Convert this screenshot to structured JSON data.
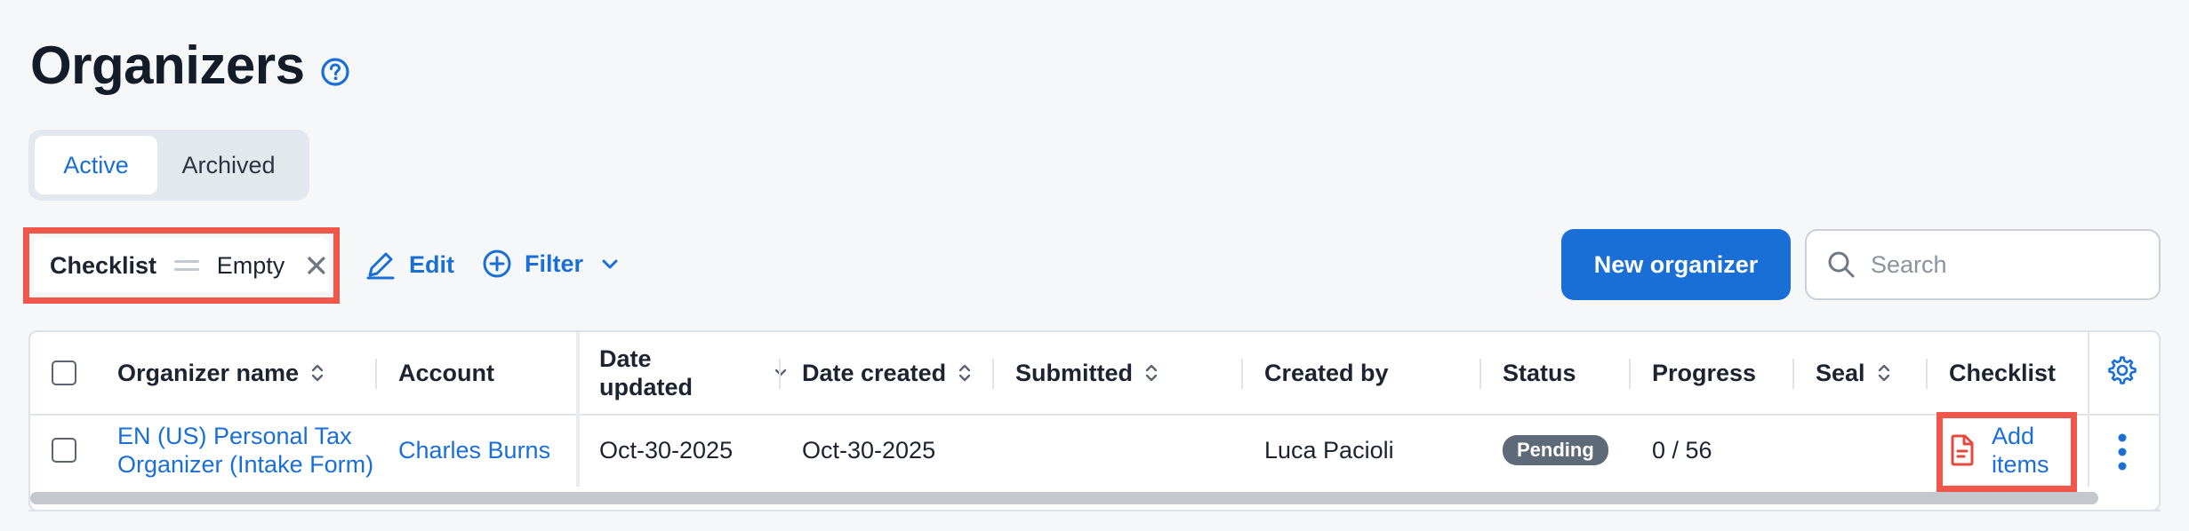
{
  "header": {
    "title": "Organizers",
    "help_icon": "help-circle-icon"
  },
  "tabs": {
    "active": "Active",
    "archived": "Archived"
  },
  "filter_chip": {
    "key": "Checklist",
    "operator_icon": "equals-icon",
    "value": "Empty",
    "remove_icon": "close-icon"
  },
  "toolbar": {
    "edit_label": "Edit",
    "filter_label": "Filter",
    "new_button": "New organizer",
    "search_placeholder": "Search"
  },
  "table": {
    "columns": {
      "organizer_name": "Organizer name",
      "account": "Account",
      "date_updated": "Date updated",
      "date_created": "Date created",
      "submitted": "Submitted",
      "created_by": "Created by",
      "status": "Status",
      "progress": "Progress",
      "seal": "Seal",
      "checklist": "Checklist"
    },
    "rows": [
      {
        "organizer_name": "EN (US) Personal Tax Organizer (Intake Form)",
        "account": "Charles Burns",
        "date_updated": "Oct-30-2025",
        "date_created": "Oct-30-2025",
        "submitted": "",
        "created_by": "Luca Pacioli",
        "status": "Pending",
        "progress": "0 / 56",
        "seal": "",
        "checklist": "Add items"
      }
    ]
  },
  "colors": {
    "accent": "#1a6fd6",
    "highlight": "#f0564a",
    "status_badge": "#5f6a79"
  }
}
